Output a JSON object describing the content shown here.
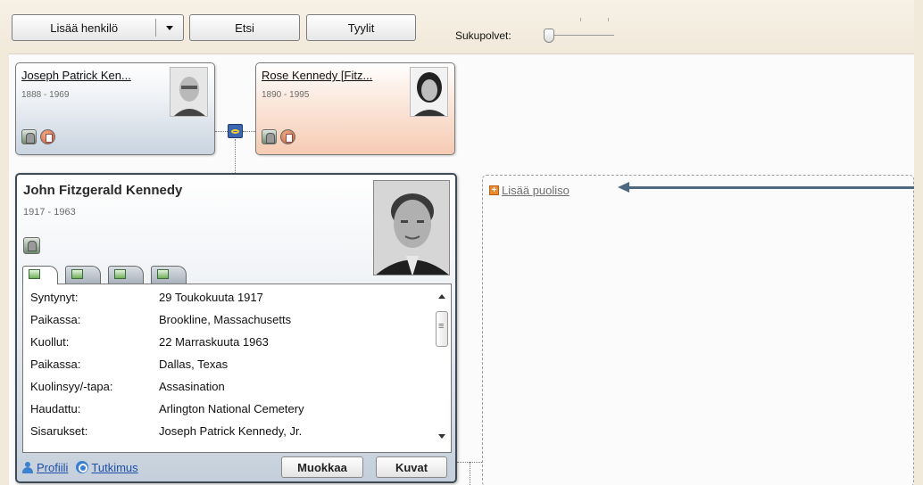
{
  "toolbar": {
    "add_person_label": "Lisää henkilö",
    "find_label": "Etsi",
    "styles_label": "Tyylit",
    "generations_label": "Sukupolvet:"
  },
  "father": {
    "name": "Joseph Patrick Ken...",
    "years": "1888 - 1969"
  },
  "mother": {
    "name": "Rose Kennedy [Fitz...",
    "years": "1890 - 1995"
  },
  "person": {
    "name": "John Fitzgerald Kennedy",
    "years": "1917 - 1963",
    "details": [
      {
        "key": "Syntynyt:",
        "value": "29 Toukokuuta 1917"
      },
      {
        "key": "Paikassa:",
        "value": "Brookline, Massachusetts"
      },
      {
        "key": "Kuollut:",
        "value": "22 Marraskuuta 1963"
      },
      {
        "key": "Paikassa:",
        "value": "Dallas, Texas"
      },
      {
        "key": "Kuolinsyy/-tapa:",
        "value": "Assasination"
      },
      {
        "key": "Haudattu:",
        "value": "Arlington National Cemetery"
      },
      {
        "key": "Sisarukset:",
        "value": "Joseph Patrick Kennedy, Jr."
      }
    ],
    "profile_link": "Profiili",
    "research_link": "Tutkimus",
    "edit_button": "Muokkaa",
    "photos_button": "Kuvat"
  },
  "spouse": {
    "add_label": "Lisää puoliso"
  },
  "colors": {
    "accent_arrow": "#4e6881",
    "link": "#1f4fa8",
    "add_icon": "#e88a2d"
  },
  "icons": [
    "dropdown-arrow-icon",
    "slider-thumb-icon",
    "gravestone-icon",
    "note-icon",
    "marriage-icon",
    "person-icon",
    "search-icon",
    "plus-icon",
    "arrow-icon"
  ]
}
